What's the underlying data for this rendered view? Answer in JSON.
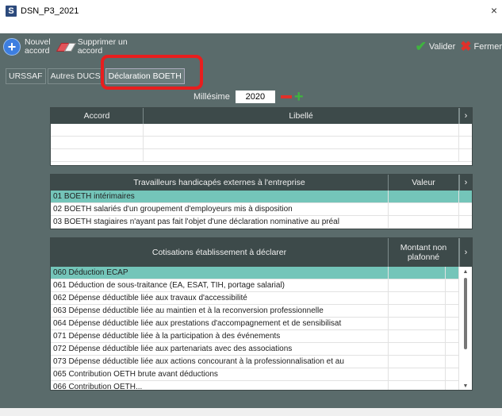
{
  "window": {
    "title": "DSN_P3_2021",
    "app_icon": "S",
    "close": "×"
  },
  "toolbar": {
    "new_label": "Nouvel\naccord",
    "delete_label": "Supprimer un\naccord",
    "validate_label": "Valider",
    "close_label": "Fermer"
  },
  "tabs": [
    {
      "label": "URSSAF"
    },
    {
      "label": "Autres DUCS"
    },
    {
      "label": "Déclaration BOETH"
    }
  ],
  "millesime": {
    "label": "Millésime",
    "value": "2020"
  },
  "accords_grid": {
    "headers": [
      "Accord",
      "Libellé"
    ],
    "rows": [
      [
        "",
        ""
      ],
      [
        "",
        ""
      ],
      [
        "",
        ""
      ],
      [
        "",
        ""
      ]
    ]
  },
  "travailleurs_grid": {
    "headers": [
      "Travailleurs handicapés externes à l'entreprise",
      "Valeur"
    ],
    "rows": [
      [
        "01 BOETH intérimaires",
        ""
      ],
      [
        "02 BOETH salariés d'un groupement d'employeurs mis à disposition",
        ""
      ],
      [
        "03 BOETH stagiaires n'ayant pas fait l'objet d'une déclaration nominative au préal",
        ""
      ]
    ]
  },
  "cotisations_grid": {
    "headers": [
      "Cotisations établissement à déclarer",
      "Montant non\nplafonné"
    ],
    "rows": [
      [
        "060 Déduction ECAP",
        ""
      ],
      [
        "061 Déduction de sous-traitance (EA, ESAT, TIH, portage salarial)",
        ""
      ],
      [
        "062 Dépense déductible liée aux travaux d'accessibilité",
        ""
      ],
      [
        "063 Dépense déductible liée au maintien et à la reconversion professionnelle",
        ""
      ],
      [
        "064 Dépense déductible liée aux prestations d'accompagnement et de sensibilisat",
        ""
      ],
      [
        "071 Dépense déductible liée à la participation à des événements",
        ""
      ],
      [
        "072 Dépense déductible liée aux partenariats avec des associations",
        ""
      ],
      [
        "073 Dépense déductible liée aux actions concourant à la professionnalisation et au",
        ""
      ],
      [
        "065 Contribution OETH brute avant déductions",
        ""
      ],
      [
        "066 Contribution OETH...",
        ""
      ]
    ]
  },
  "colors": {
    "toolbar_bg": "#5a6b6b",
    "header_bg": "#3d4a4a",
    "selected_row": "#74c5b9",
    "highlight_box": "#e81e1e"
  },
  "icons": [
    "app-icon",
    "add-icon",
    "eraser-icon",
    "check-icon",
    "cross-icon",
    "minus-icon",
    "plus-icon",
    "chevron-right-icon"
  ]
}
